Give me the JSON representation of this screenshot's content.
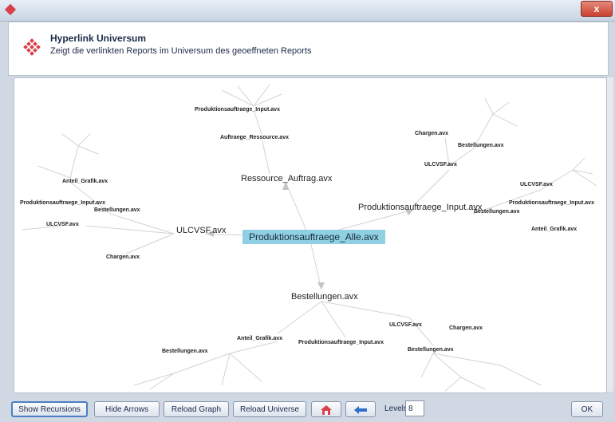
{
  "window": {
    "close_label": "x"
  },
  "header": {
    "title": "Hyperlink Universum",
    "subtitle": "Zeigt die verlinkten Reports im Universum des geoeffneten Reports"
  },
  "graph": {
    "root": "Produktionsauftraege_Alle.avx",
    "nodes": {
      "ressource_auftrag": "Ressource_Auftrag.avx",
      "produktionsauftraege_input_top": "Produktionsauftraege_Input.avx",
      "auftraege_ressource": "Auftraege_Ressource.avx",
      "produktionsauftraege_input_right": "Produktionsauftraege_Input.avx",
      "chargen_right": "Chargen.avx",
      "bestellungen_right_top": "Bestellungen.avx",
      "ulcvsf_right": "ULCVSF.avx",
      "ulcvsf_far_right": "ULCVSF.avx",
      "produktionsauftraege_input_far_right": "Produktionsauftraege_Input.avx",
      "bestellungen_far_right": "Bestellungen.avx",
      "anteil_grafik_far_right": "Anteil_Grafik.avx",
      "ulcvsf_left": "ULCVSF.avx",
      "anteil_grafik_left": "Anteil_Grafik.avx",
      "produktionsauftraege_input_left": "Produktionsauftraege_Input.avx",
      "bestellungen_left": "Bestellungen.avx",
      "ulcvsf_far_left": "ULCVSF.avx",
      "chargen_left": "Chargen.avx",
      "bestellungen_bottom": "Bestellungen.avx",
      "anteil_grafik_bottom": "Anteil_Grafik.avx",
      "bestellungen_bottom_left": "Bestellungen.avx",
      "produktionsauftraege_input_bottom": "Produktionsauftraege_Input.avx",
      "ulcvsf_bottom": "ULCVSF.avx",
      "chargen_bottom": "Chargen.avx",
      "bestellungen_bottom_right": "Bestellungen.avx"
    }
  },
  "toolbar": {
    "show_recursions": "Show Recursions",
    "hide_arrows": "Hide Arrows",
    "reload_graph": "Reload Graph",
    "reload_universe": "Reload Universe",
    "home_icon": "home-icon",
    "back_icon": "arrow-left-icon",
    "levels_label": "Levels",
    "levels_value": "8",
    "ok": "OK"
  },
  "colors": {
    "root_highlight": "#8fd0e3",
    "accent": "#d8404a"
  }
}
